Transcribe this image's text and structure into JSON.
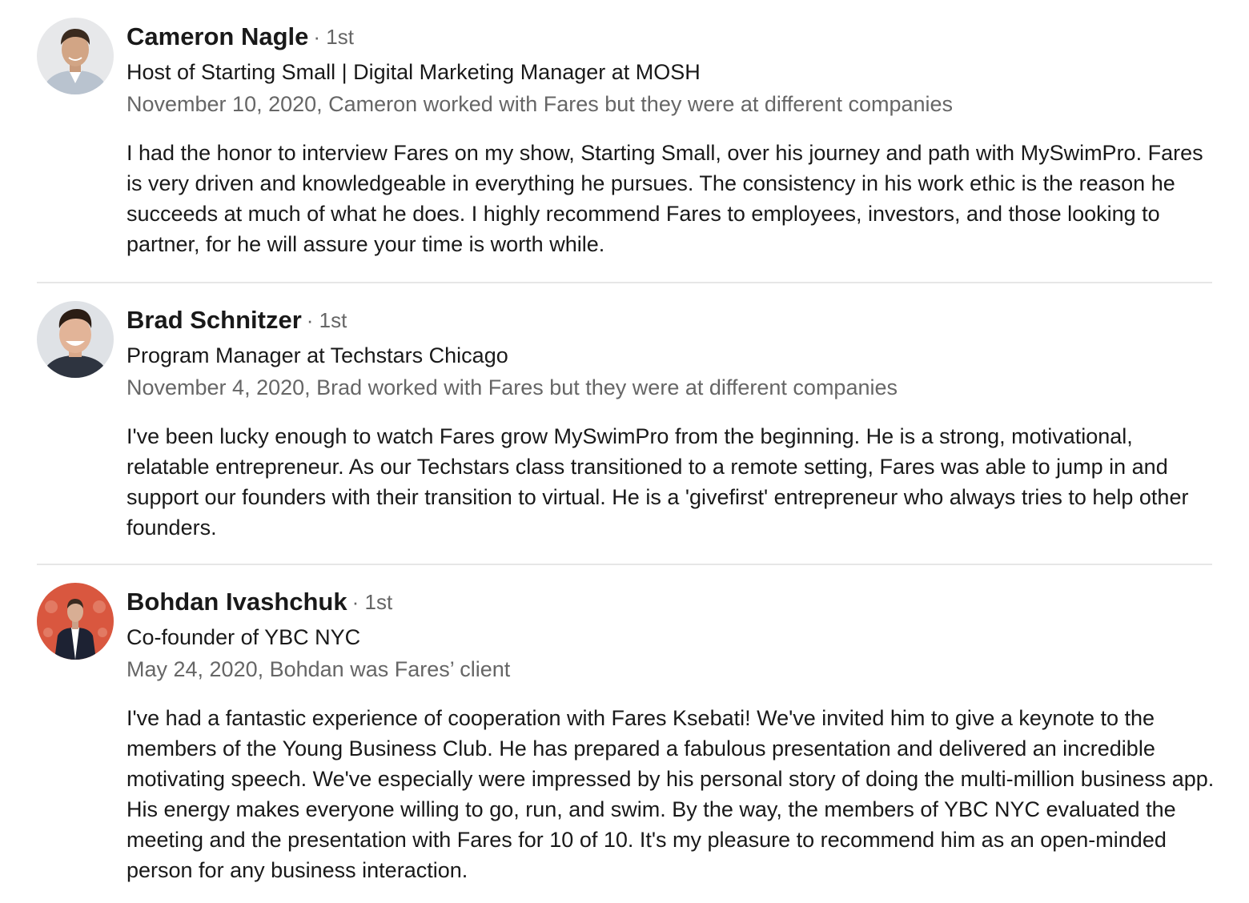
{
  "recommendations": [
    {
      "name": "Cameron Nagle",
      "degree": "· 1st",
      "headline": "Host of Starting Small | Digital Marketing Manager at MOSH",
      "meta": "November 10, 2020, Cameron worked with Fares but they were at different companies",
      "text": "I had the honor to interview Fares on my show, Starting Small, over his journey and path with MySwimPro. Fares is very driven and knowledgeable in everything he pursues. The consistency in his work ethic is the reason he succeeds at much of what he does. I highly recommend Fares to employees, investors, and those looking to partner, for he will assure your time is worth while."
    },
    {
      "name": "Brad Schnitzer",
      "degree": "· 1st",
      "headline": "Program Manager at Techstars Chicago",
      "meta": "November 4, 2020, Brad worked with Fares but they were at different companies",
      "text": "I've been lucky enough to watch Fares grow MySwimPro from the beginning. He is a strong, motivational, relatable entrepreneur. As our Techstars class transitioned to a remote setting, Fares was able to jump in and support our founders with their transition to virtual. He is a 'givefirst' entrepreneur who always tries to help other founders."
    },
    {
      "name": "Bohdan Ivashchuk",
      "degree": "· 1st",
      "headline": "Co-founder of YBC NYC",
      "meta": "May 24, 2020, Bohdan was Fares’ client",
      "text": "I've had a fantastic experience of cooperation with Fares Ksebati! We've invited him to give a keynote to the members of the Young Business Club. He has prepared a fabulous presentation and delivered an incredible motivating speech. We've especially were impressed by his personal story of doing the multi-million business app. His energy makes everyone willing to go, run, and swim. By the way, the members of YBC NYC evaluated the meeting and the presentation with Fares for 10 of 10. It's my pleasure to recommend him as an open-minded person for any business interaction."
    }
  ]
}
